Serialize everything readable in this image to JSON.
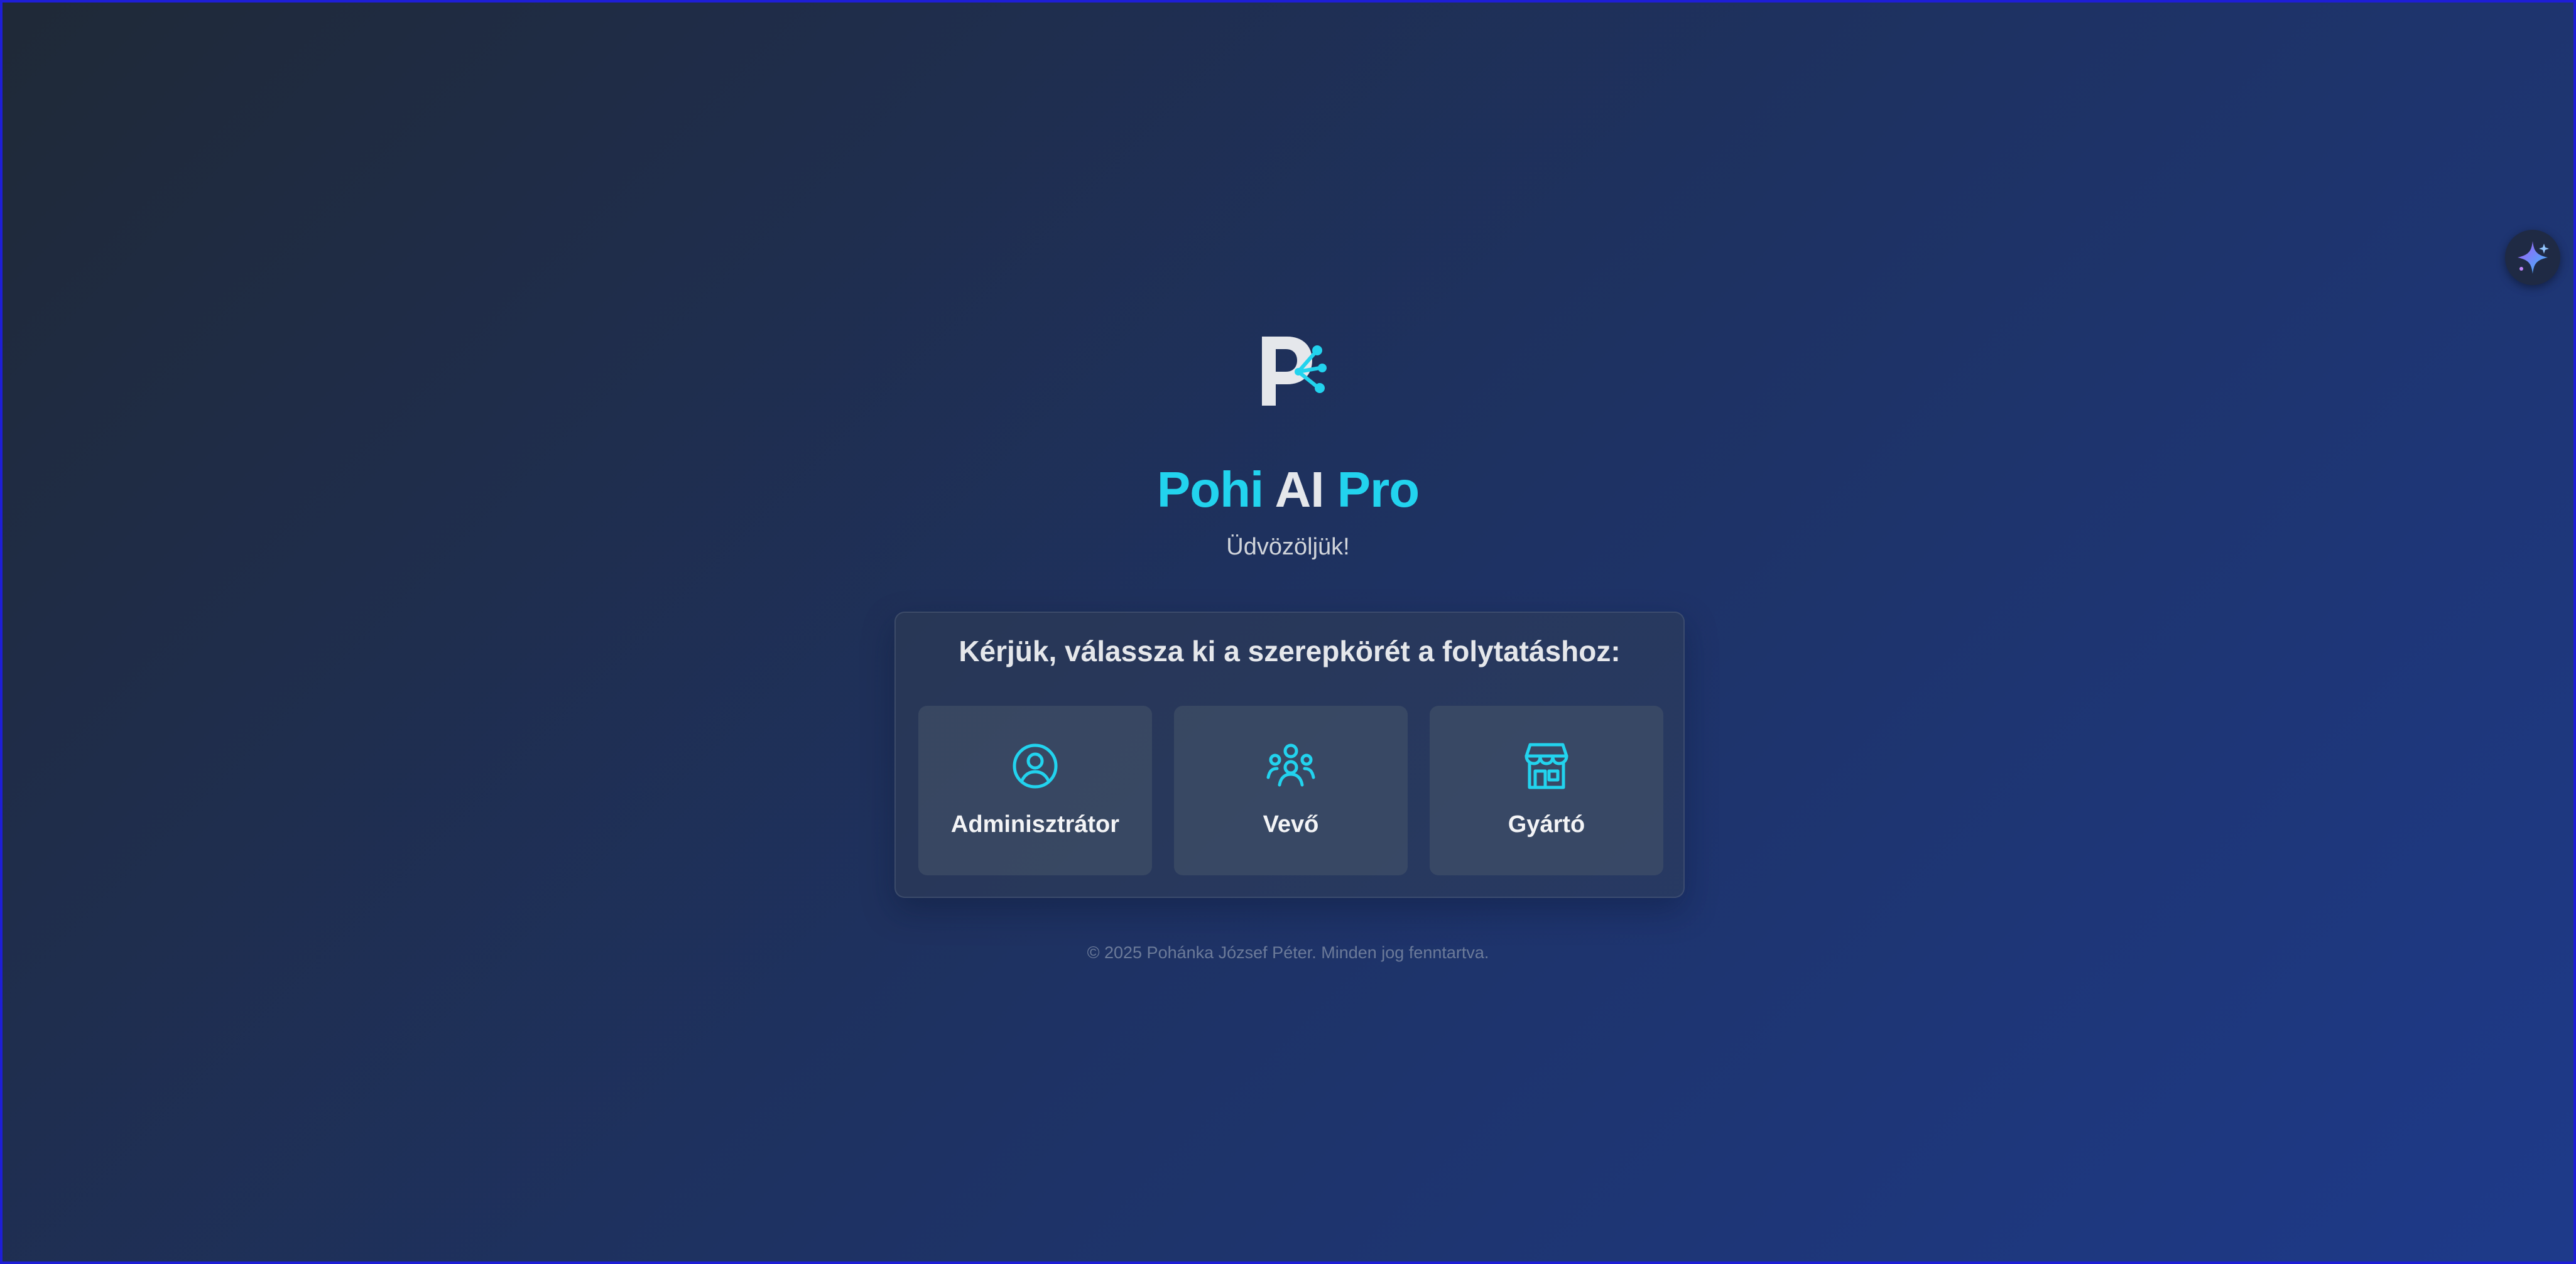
{
  "app": {
    "title_part1": "Pohi",
    "title_part2": "AI",
    "title_part3": "Pro",
    "subtitle": "Üdvözöljük!"
  },
  "role_selection": {
    "heading": "Kérjük, válassza ki a szerepkörét a folytatáshoz:",
    "roles": [
      {
        "label": "Adminisztrátor",
        "icon": "user-circle-icon"
      },
      {
        "label": "Vevő",
        "icon": "users-group-icon"
      },
      {
        "label": "Gyártó",
        "icon": "store-icon"
      }
    ]
  },
  "footer": {
    "copyright": "© 2025 Pohánka József Péter. Minden jog fenntartva."
  },
  "assistant": {
    "icon": "sparkle-icon"
  },
  "colors": {
    "accent": "#22d3ee",
    "background_start": "#1f2937",
    "background_end": "#1e3a8a",
    "text": "#e5e7eb"
  }
}
